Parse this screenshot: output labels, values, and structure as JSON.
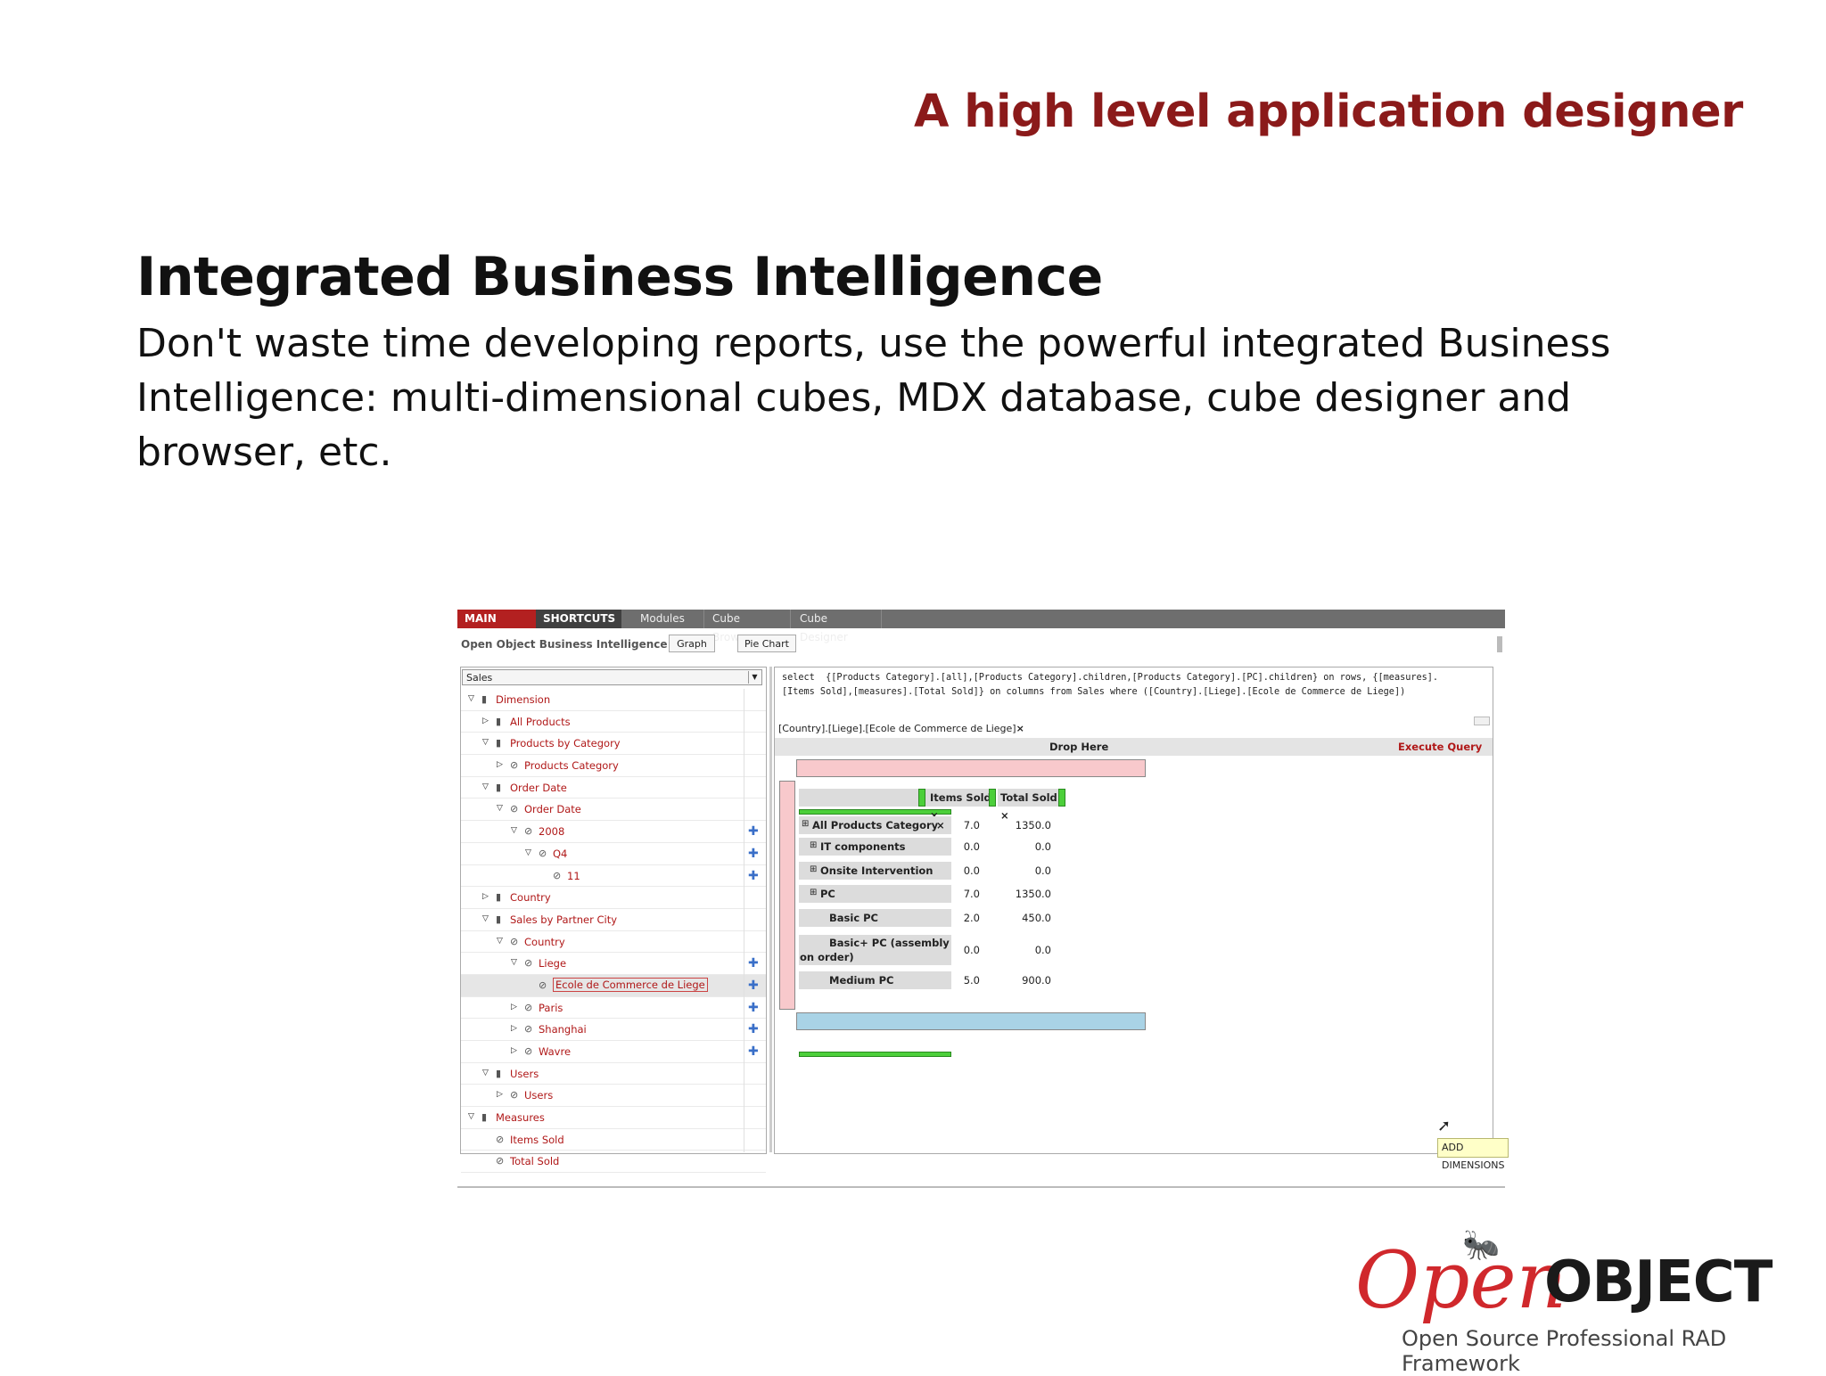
{
  "slide": {
    "header_title": "A high level application designer",
    "section_title": "Integrated Business Intelligence",
    "section_body": "Don't waste time developing reports, use the powerful integrated Business Intelligence: multi-dimensional cubes, MDX database, cube designer and browser, etc."
  },
  "app": {
    "topbar": {
      "main_menu": "MAIN MENU",
      "shortcuts": "SHORTCUTS",
      "modules": "Modules",
      "cube_browser": "Cube Browser",
      "cube_designer": "Cube Designer"
    },
    "title": "Open Object Business Intelligence",
    "graph_button": "Graph",
    "pie_chart_button": "Pie Chart",
    "cube_select": "Sales",
    "tree": [
      {
        "label": "Dimension",
        "level": 0,
        "toggle": "open",
        "icon": "book",
        "plus": false
      },
      {
        "label": "All Products",
        "level": 1,
        "toggle": "closed",
        "icon": "book",
        "plus": false
      },
      {
        "label": "Products by Category",
        "level": 1,
        "toggle": "open",
        "icon": "book",
        "plus": false
      },
      {
        "label": "Products Category",
        "level": 2,
        "toggle": "closed",
        "icon": "level",
        "plus": false
      },
      {
        "label": "Order Date",
        "level": 1,
        "toggle": "open",
        "icon": "book",
        "plus": false
      },
      {
        "label": "Order Date",
        "level": 2,
        "toggle": "open",
        "icon": "level",
        "plus": false
      },
      {
        "label": "2008",
        "level": 3,
        "toggle": "open",
        "icon": "level",
        "plus": true
      },
      {
        "label": "Q4",
        "level": 4,
        "toggle": "open",
        "icon": "level",
        "plus": true
      },
      {
        "label": "11",
        "level": 5,
        "toggle": "none",
        "icon": "level",
        "plus": true
      },
      {
        "label": "Country",
        "level": 1,
        "toggle": "closed",
        "icon": "book",
        "plus": false
      },
      {
        "label": "Sales by Partner City",
        "level": 1,
        "toggle": "open",
        "icon": "book",
        "plus": false
      },
      {
        "label": "Country",
        "level": 2,
        "toggle": "open",
        "icon": "level",
        "plus": false
      },
      {
        "label": "Liege",
        "level": 3,
        "toggle": "open",
        "icon": "level",
        "plus": true
      },
      {
        "label": "Ecole de Commerce de Liege",
        "level": 4,
        "toggle": "none",
        "icon": "level",
        "plus": true,
        "selected": true
      },
      {
        "label": "Paris",
        "level": 3,
        "toggle": "closed",
        "icon": "level",
        "plus": true
      },
      {
        "label": "Shanghai",
        "level": 3,
        "toggle": "closed",
        "icon": "level",
        "plus": true
      },
      {
        "label": "Wavre",
        "level": 3,
        "toggle": "closed",
        "icon": "level",
        "plus": true
      },
      {
        "label": "Users",
        "level": 1,
        "toggle": "open",
        "icon": "book",
        "plus": false
      },
      {
        "label": "Users",
        "level": 2,
        "toggle": "closed",
        "icon": "level",
        "plus": false
      },
      {
        "label": "Measures",
        "level": 0,
        "toggle": "open",
        "icon": "book",
        "plus": false
      },
      {
        "label": "Items Sold",
        "level": 1,
        "toggle": "none",
        "icon": "level",
        "plus": false
      },
      {
        "label": "Total Sold",
        "level": 1,
        "toggle": "none",
        "icon": "level",
        "plus": false
      }
    ],
    "query": "select  {[Products Category].[all],[Products Category].children,[Products Category].[PC].children} on rows, {[measures].\n[Items Sold],[measures].[Total Sold]} on columns from Sales where ([Country].[Liege].[Ecole de Commerce de Liege])",
    "slicer": "[Country].[Liege].[Ecole de Commerce de Liege]",
    "slicer_close": "×",
    "drop_here": "Drop Here",
    "execute_query": "Execute Query",
    "measures": [
      {
        "label": "Items Sold",
        "close": "×"
      },
      {
        "label": "Total Sold",
        "close": "×"
      }
    ],
    "rows": [
      {
        "label": "All Products Category",
        "close": "×",
        "expander": "⊞",
        "items_sold": "7.0",
        "total_sold": "1350.0"
      },
      {
        "label": "IT components",
        "close": "",
        "expander": "⊞",
        "items_sold": "0.0",
        "total_sold": "0.0"
      },
      {
        "label": "Onsite Intervention",
        "close": "",
        "expander": "⊞",
        "items_sold": "0.0",
        "total_sold": "0.0"
      },
      {
        "label": "PC",
        "close": "",
        "expander": "⊞",
        "items_sold": "7.0",
        "total_sold": "1350.0"
      },
      {
        "label": "Basic PC",
        "close": "",
        "expander": "",
        "items_sold": "2.0",
        "total_sold": "450.0"
      },
      {
        "label": "Basic+ PC (assembly on order)",
        "line1": "Basic+ PC (assembly",
        "line2": "on order)",
        "close": "",
        "expander": "",
        "items_sold": "0.0",
        "total_sold": "0.0"
      },
      {
        "label": "Medium PC",
        "close": "",
        "expander": "",
        "items_sold": "5.0",
        "total_sold": "900.0"
      }
    ],
    "tooltip": "ADD DIMENSIONS"
  },
  "logo": {
    "open": "Open",
    "object": "OBJECT",
    "tagline": "Open Source Professional RAD Framework"
  },
  "colors": {
    "accent": "#8b1a1a",
    "tree_text": "#b01818",
    "main_menu": "#b32020",
    "pink_zone": "#f8c9cc",
    "blue_zone": "#a9d3e6",
    "green_handle": "#4ccf3a"
  },
  "icons": {
    "book": "book-icon",
    "level": "level-icon",
    "plus": "add-icon",
    "expand": "triangle-right-icon",
    "collapse": "triangle-down-icon",
    "cursor": "mouse-cursor-icon"
  }
}
